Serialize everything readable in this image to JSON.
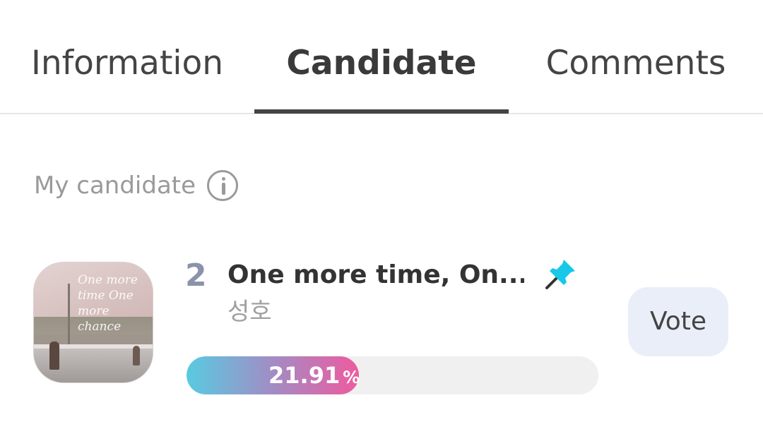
{
  "tabs": [
    {
      "label": "Information",
      "active": false
    },
    {
      "label": "Candidate",
      "active": true
    },
    {
      "label": "Comments",
      "active": false
    }
  ],
  "section": {
    "label": "My candidate",
    "info_icon": "info-circle-icon"
  },
  "candidate": {
    "rank": "2",
    "title": "One more time, On...",
    "subtitle": "성호",
    "thumbnail_text": "One more time One more chance",
    "pin_icon": "pin-icon",
    "pin_color": "#18c8e8",
    "progress": {
      "value_text": "21.91",
      "unit": "%",
      "fraction": 0.4186
    },
    "vote_label": "Vote"
  },
  "colors": {
    "accent_gradient_start": "#58cbe1",
    "accent_gradient_end": "#ef5a9f",
    "vote_button_bg": "#eaeef8",
    "rank_color": "#8a93aa"
  }
}
